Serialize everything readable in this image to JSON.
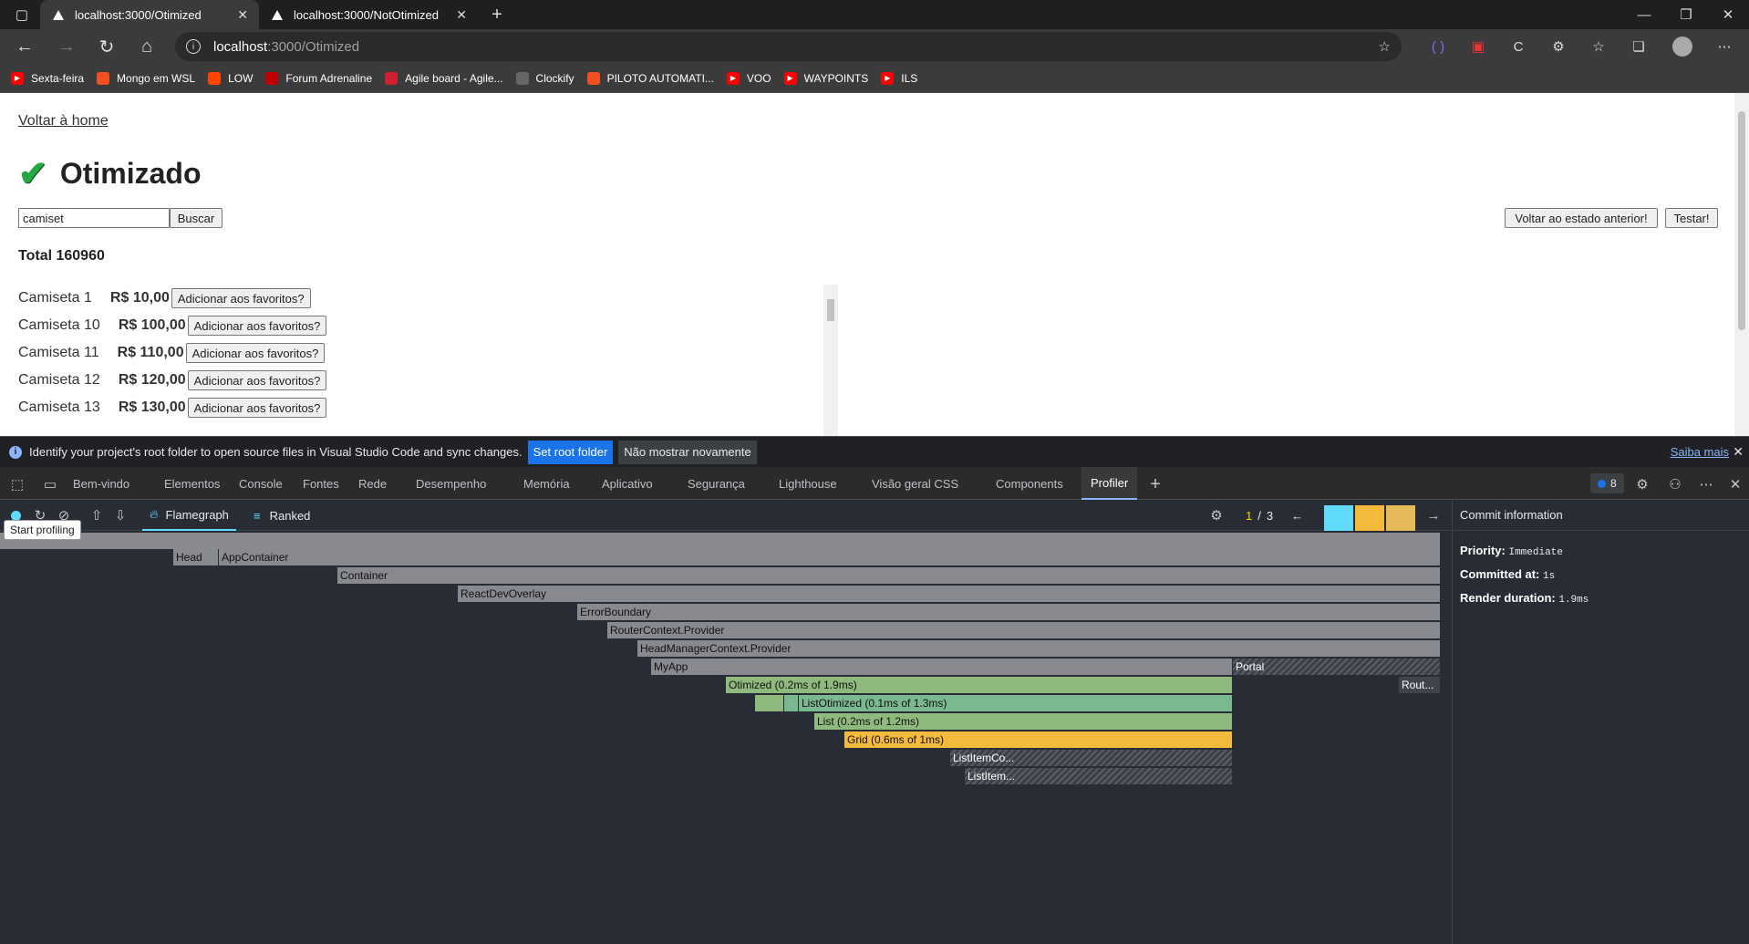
{
  "browser": {
    "tabs": [
      {
        "title": "localhost:3000/Otimized",
        "active": true
      },
      {
        "title": "localhost:3000/NotOtimized",
        "active": false
      }
    ],
    "url_host": "localhost",
    "url_path": ":3000/Otimized",
    "bookmarks": [
      {
        "label": "Sexta-feira",
        "icon": "youtube-icon",
        "color": "#ff0000"
      },
      {
        "label": "Mongo em WSL",
        "icon": "windows-icon",
        "color": "#f25022"
      },
      {
        "label": "LOW",
        "icon": "reddit-icon",
        "color": "#ff4500"
      },
      {
        "label": "Forum Adrenaline",
        "icon": "adrenaline-icon",
        "color": "#c00000"
      },
      {
        "label": "Agile board - Agile...",
        "icon": "up-icon",
        "color": "#d01f2f"
      },
      {
        "label": "Clockify",
        "icon": "clockify-icon",
        "color": "#666666"
      },
      {
        "label": "PILOTO AUTOMATI...",
        "icon": "windows-icon",
        "color": "#f25022"
      },
      {
        "label": "VOO",
        "icon": "youtube-icon",
        "color": "#ff0000"
      },
      {
        "label": "WAYPOINTS",
        "icon": "youtube-icon",
        "color": "#ff0000"
      },
      {
        "label": "ILS",
        "icon": "youtube-icon",
        "color": "#ff0000"
      }
    ]
  },
  "page": {
    "home_link": "Voltar à home",
    "title": "Otimizado",
    "search_value": "camiset",
    "search_button": "Buscar",
    "undo_button": "Voltar ao estado anterior!",
    "test_button": "Testar!",
    "total": "Total 160960",
    "favorite_label": "Adicionar aos favoritos?",
    "products": [
      {
        "name": "Camiseta 1",
        "price": "R$ 10,00"
      },
      {
        "name": "Camiseta 10",
        "price": "R$ 100,00"
      },
      {
        "name": "Camiseta 11",
        "price": "R$ 110,00"
      },
      {
        "name": "Camiseta 12",
        "price": "R$ 120,00"
      },
      {
        "name": "Camiseta 13",
        "price": "R$ 130,00"
      }
    ]
  },
  "devtools": {
    "infobar": {
      "message": "Identify your project's root folder to open source files in Visual Studio Code and sync changes.",
      "set_root": "Set root folder",
      "dismiss": "Não mostrar novamente",
      "learn_more": "Saiba mais"
    },
    "tabs": [
      "Bem-vindo",
      "Elementos",
      "Console",
      "Fontes",
      "Rede",
      "Desempenho",
      "Memória",
      "Aplicativo",
      "Segurança",
      "Lighthouse",
      "Visão geral CSS",
      "Components",
      "Profiler"
    ],
    "issues_count": "8",
    "profiler": {
      "tab_flamegraph": "Flamegraph",
      "tab_ranked": "Ranked",
      "tooltip": "Start profiling",
      "commit_current": "1",
      "commit_sep": "/",
      "commit_total": "3",
      "commits": [
        {
          "color": "#61dafb"
        },
        {
          "color": "#f4ba3c"
        },
        {
          "color": "#e5bb5a"
        }
      ],
      "flame": {
        "head": "Head",
        "app_container": "AppContainer",
        "container": "Container",
        "react_dev_overlay": "ReactDevOverlay",
        "error_boundary": "ErrorBoundary",
        "router_context": "RouterContext.Provider",
        "head_manager": "HeadManagerContext.Provider",
        "my_app": "MyApp",
        "portal": "Portal",
        "otimized": "Otimized (0.2ms of 1.9ms)",
        "router_short": "Rout...",
        "list_otimized": "ListOtimized (0.1ms of 1.3ms)",
        "list": "List (0.2ms of 1.2ms)",
        "grid": "Grid (0.6ms of 1ms)",
        "list_item_co": "ListItemCo...",
        "list_item": "ListItem..."
      }
    },
    "commit_info": {
      "header": "Commit information",
      "priority_label": "Priority:",
      "priority_value": "Immediate",
      "committed_label": "Committed at:",
      "committed_value": "1s",
      "duration_label": "Render duration:",
      "duration_value": "1.9ms"
    }
  }
}
